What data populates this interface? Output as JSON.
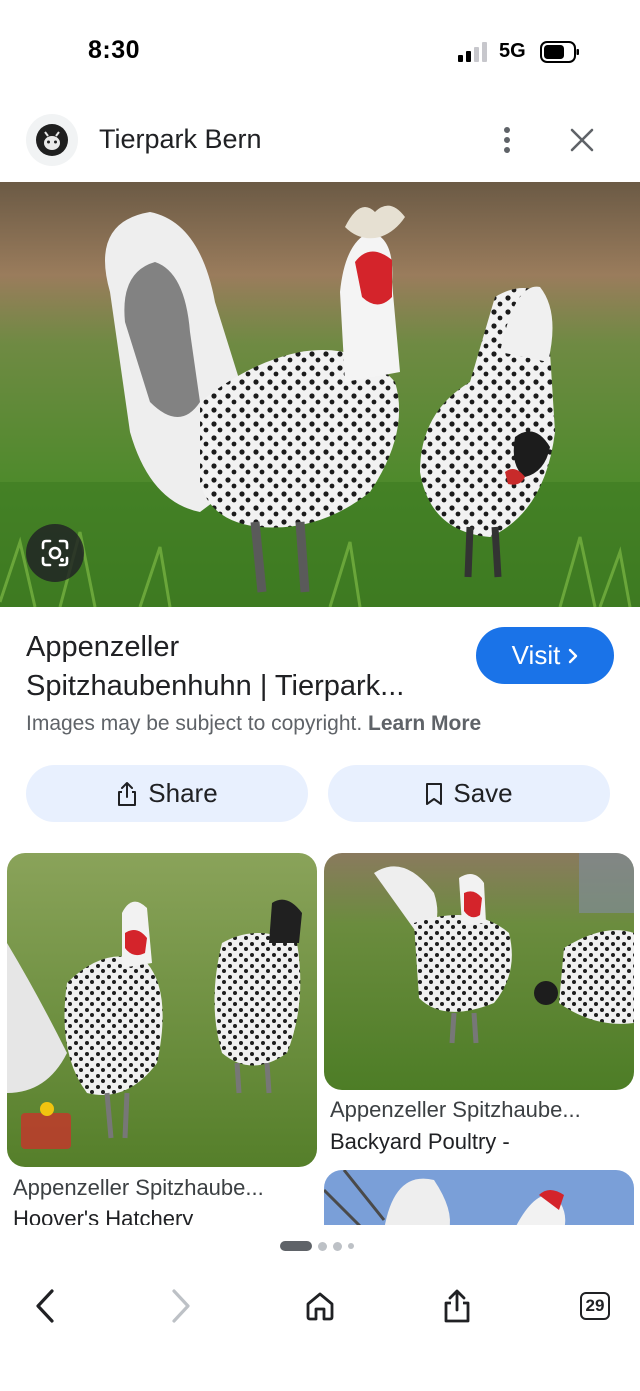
{
  "status_bar": {
    "time": "8:30",
    "network": "5G",
    "icons": [
      "signal-icon",
      "battery-icon"
    ]
  },
  "header": {
    "site_name": "Tierpark Bern",
    "icons": [
      "site-logo-icon",
      "more-vert-icon",
      "close-icon"
    ]
  },
  "main_image": {
    "lens_icon": "google-lens-icon"
  },
  "result": {
    "title_line1": "Appenzeller",
    "title_line2": "Spitzhaubenhuhn | Tierpark...",
    "visit_label": "Visit",
    "visit_icon": "chevron-right-icon",
    "copyright_text": "Images may be subject to copyright.",
    "learn_more": "Learn More"
  },
  "actions": {
    "share_label": "Share",
    "save_label": "Save",
    "share_icon": "share-icon",
    "save_icon": "bookmark-icon"
  },
  "related": [
    {
      "title": "Appenzeller Spitzhaube...",
      "source": "Hoover's Hatchery"
    },
    {
      "title": "Appenzeller Spitzhaube...",
      "source": "Backyard Poultry -"
    }
  ],
  "pager": {
    "pages": 4,
    "active_index": 0
  },
  "toolbar": {
    "tab_count": "29",
    "icons": [
      "back-icon",
      "forward-icon",
      "home-icon",
      "share-icon",
      "tabs-icon"
    ]
  },
  "colors": {
    "accent": "#1a73e8",
    "action_bg": "#e8f0fe",
    "text_primary": "#202124",
    "text_secondary": "#5f6368"
  }
}
